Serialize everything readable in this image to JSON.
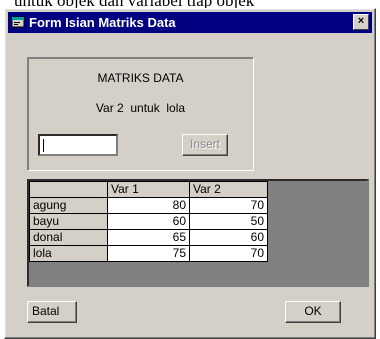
{
  "background_text": "untuk objek dan variabel tiap objek",
  "window": {
    "title": "Form Isian Matriks Data",
    "close_label": "×",
    "icon": "form-app-icon"
  },
  "panel": {
    "title": "MATRIKS DATA",
    "subtitle": "Var 2  untuk  lola",
    "input_value": "",
    "insert_label": "Insert"
  },
  "grid": {
    "columns": [
      "",
      "Var 1",
      "Var 2"
    ],
    "rows": [
      {
        "name": "agung",
        "var1": "80",
        "var2": "70"
      },
      {
        "name": "bayu",
        "var1": "60",
        "var2": "50"
      },
      {
        "name": "donal",
        "var1": "65",
        "var2": "60"
      },
      {
        "name": "lola",
        "var1": "75",
        "var2": "70"
      }
    ]
  },
  "buttons": {
    "batal_label": "Batal",
    "ok_label": "OK"
  },
  "colors": {
    "titlebar": "#000080",
    "face": "#d4d0c8"
  }
}
